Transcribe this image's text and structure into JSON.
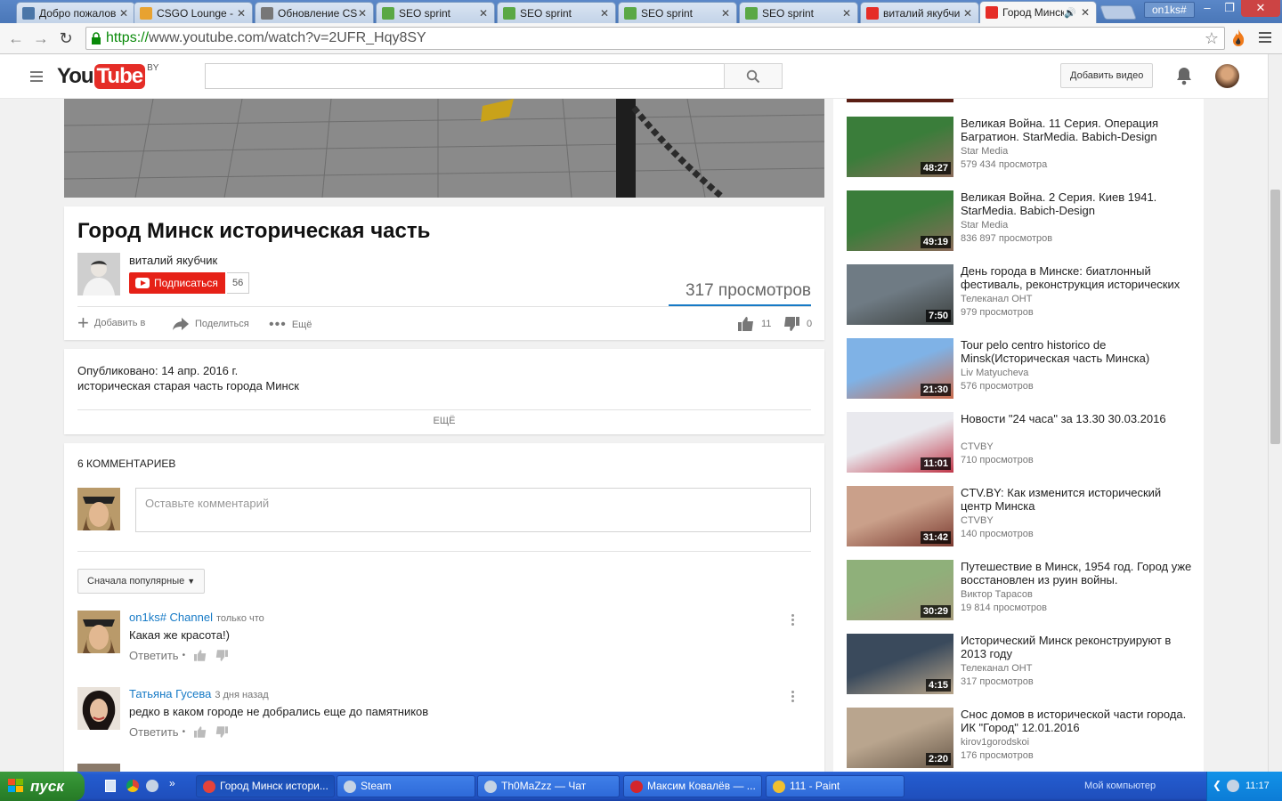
{
  "browser": {
    "tabs": [
      {
        "label": "Добро пожалов",
        "icon": "vk-icon",
        "color": "#4a76a8"
      },
      {
        "label": "CSGO Lounge - N",
        "icon": "csgo-lounge-icon",
        "color": "#e8a230"
      },
      {
        "label": "Обновление CS",
        "icon": "web-icon",
        "color": "#777777"
      },
      {
        "label": "SEO sprint",
        "icon": "seosprint-icon",
        "color": "#5aa845"
      },
      {
        "label": "SEO sprint",
        "icon": "seosprint-icon",
        "color": "#5aa845"
      },
      {
        "label": "SEO sprint",
        "icon": "seosprint-icon",
        "color": "#5aa845"
      },
      {
        "label": "SEO sprint",
        "icon": "seosprint-icon",
        "color": "#5aa845"
      },
      {
        "label": "виталий якубчи",
        "icon": "youtube-icon",
        "color": "#e52d27"
      },
      {
        "label": "Город Минск",
        "icon": "youtube-icon",
        "color": "#e52d27",
        "active": true
      }
    ],
    "profile": "on1ks#",
    "url_scheme": "https://",
    "url_rest": "www.youtube.com/watch?v=2UFR_Hqy8SY"
  },
  "yt": {
    "logo_you": "You",
    "logo_tube": "Tube",
    "logo_country": "BY",
    "upload_label": "Добавить видео"
  },
  "video": {
    "title": "Город Минск историческая часть",
    "channel": "виталий якубчик",
    "subscribe_label": "Подписаться",
    "subscriber_count": "56",
    "views": "317 просмотров",
    "add_to": "Добавить в",
    "share": "Поделиться",
    "more": "Ещё",
    "likes": "11",
    "dislikes": "0"
  },
  "description": {
    "published": "Опубликовано: 14 апр. 2016 г.",
    "text": "историческая старая часть города Минск",
    "more_label": "ЕЩЁ"
  },
  "comments": {
    "count_label": "6 комментариев",
    "placeholder": "Оставьте комментарий",
    "sort_label": "Сначала популярные",
    "reply_label": "Ответить",
    "items": [
      {
        "author": "on1ks# Channel",
        "time": "только что",
        "text": "Какая же красота!)"
      },
      {
        "author": "Татьяна Гусева",
        "time": "3 дня назад",
        "text": "редко в каком городе не добрались еще до памятников"
      }
    ]
  },
  "related": [
    {
      "title": "Великая Война. 11 Серия. Операция Багратион. StarMedia. Babich-Design",
      "channel": "Star Media",
      "views": "579 434 просмотра",
      "duration": "48:27",
      "colors": [
        "#3a7d3a",
        "#8a6b5a"
      ]
    },
    {
      "title": "Великая Война. 2 Серия. Киев 1941. StarMedia. Babich-Design",
      "channel": "Star Media",
      "views": "836 897 просмотров",
      "duration": "49:19",
      "colors": [
        "#3a7d3a",
        "#8a6b5a"
      ]
    },
    {
      "title": "День города в Минске: биатлонный фестиваль, реконструкция исторических",
      "channel": "Телеканал ОНТ",
      "views": "979 просмотров",
      "duration": "7:50",
      "colors": [
        "#6f7b84",
        "#3b3f3d"
      ]
    },
    {
      "title": "Tour pelo centro historico de Minsk(Историческая часть Минска)",
      "channel": "Liv Matyucheva",
      "views": "576 просмотров",
      "duration": "21:30",
      "colors": [
        "#7fb2e6",
        "#c96a4a"
      ]
    },
    {
      "title": "Новости \"24 часа\" за 13.30 30.03.2016",
      "channel": "CTVBY",
      "views": "710 просмотров",
      "duration": "11:01",
      "colors": [
        "#e9e9ee",
        "#c0384a"
      ]
    },
    {
      "title": "CTV.BY: Как изменится исторический центр Минска",
      "channel": "CTVBY",
      "views": "140 просмотров",
      "duration": "31:42",
      "colors": [
        "#caa08a",
        "#7a3a30"
      ]
    },
    {
      "title": "Путешествие в Минск, 1954 год. Город уже восстановлен из руин войны.",
      "channel": "Виктор Тарасов",
      "views": "19 814 просмотров",
      "duration": "30:29",
      "colors": [
        "#8fb07a",
        "#a49a7a"
      ]
    },
    {
      "title": "Исторический Минск реконструируют в 2013 году",
      "channel": "Телеканал ОНТ",
      "views": "317 просмотров",
      "duration": "4:15",
      "colors": [
        "#3a4a5c",
        "#b8a58a"
      ]
    },
    {
      "title": "Снос домов в исторической части города. ИК \"Город\" 12.01.2016",
      "channel": "kirov1gorodskoi",
      "views": "176 просмотров",
      "duration": "2:20",
      "colors": [
        "#b9a58e",
        "#6a5a4a"
      ]
    }
  ],
  "taskbar": {
    "start_label": "пуск",
    "buttons": [
      {
        "label": "Город Минск истори...",
        "icon": "chrome-icon",
        "color": "#e5433a",
        "active": true
      },
      {
        "label": "Steam",
        "icon": "steam-icon",
        "color": "#c5d3e4"
      },
      {
        "label": "Th0MaZzz — Чат",
        "icon": "steam-icon",
        "color": "#c5d3e4"
      },
      {
        "label": "Максим Ковалёв — ...",
        "icon": "opera-icon",
        "color": "#d4262c"
      },
      {
        "label": "111 - Paint",
        "icon": "paint-icon",
        "color": "#f0c030"
      }
    ],
    "tray_label": "Мой компьютер",
    "clock": "11:17"
  }
}
